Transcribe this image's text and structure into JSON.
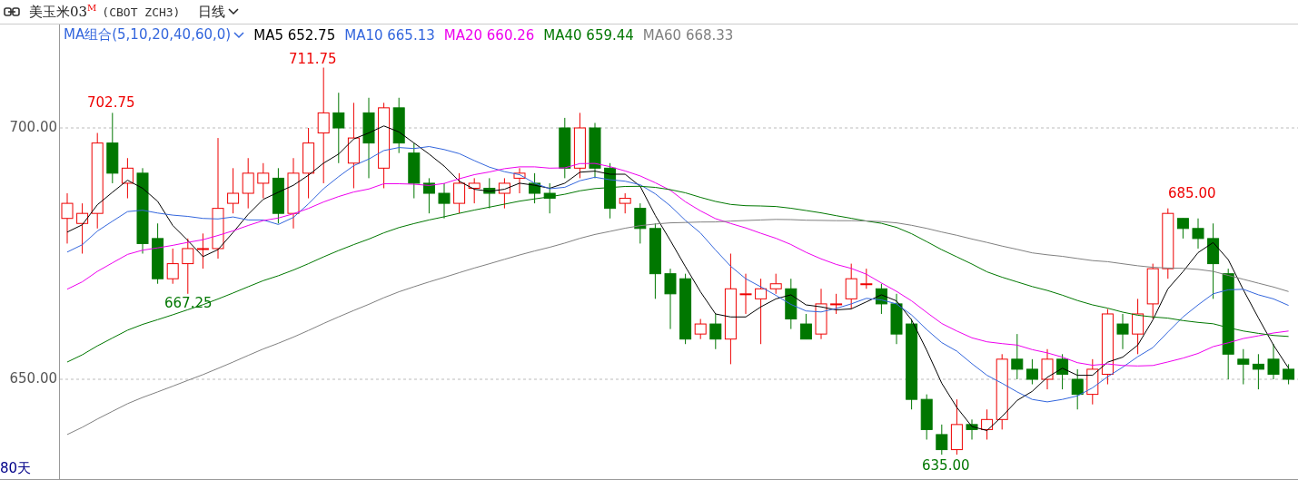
{
  "header": {
    "title": "美玉米03$^{M}$",
    "code": "(CBOT ZCH3)",
    "period": "日线"
  },
  "legend": {
    "label": "MA组合(5,10,20,40,60,0)",
    "items": [
      {
        "name": "MA5",
        "value": "652.75",
        "color": "#000000"
      },
      {
        "name": "MA10",
        "value": "665.13",
        "color": "#3366dd"
      },
      {
        "name": "MA20",
        "value": "660.26",
        "color": "#ee00ee"
      },
      {
        "name": "MA40",
        "value": "659.44",
        "color": "#007700"
      },
      {
        "name": "MA60",
        "value": "668.33",
        "color": "#808080"
      }
    ]
  },
  "axis": {
    "ticks": [
      "700.00",
      "650.00"
    ]
  },
  "annotations": [
    {
      "text": "702.75",
      "kind": "high"
    },
    {
      "text": "711.75",
      "kind": "high"
    },
    {
      "text": "667.25",
      "kind": "low"
    },
    {
      "text": "635.00",
      "kind": "low"
    },
    {
      "text": "685.00",
      "kind": "high"
    }
  ],
  "footer": {
    "range": "80天"
  }
}
